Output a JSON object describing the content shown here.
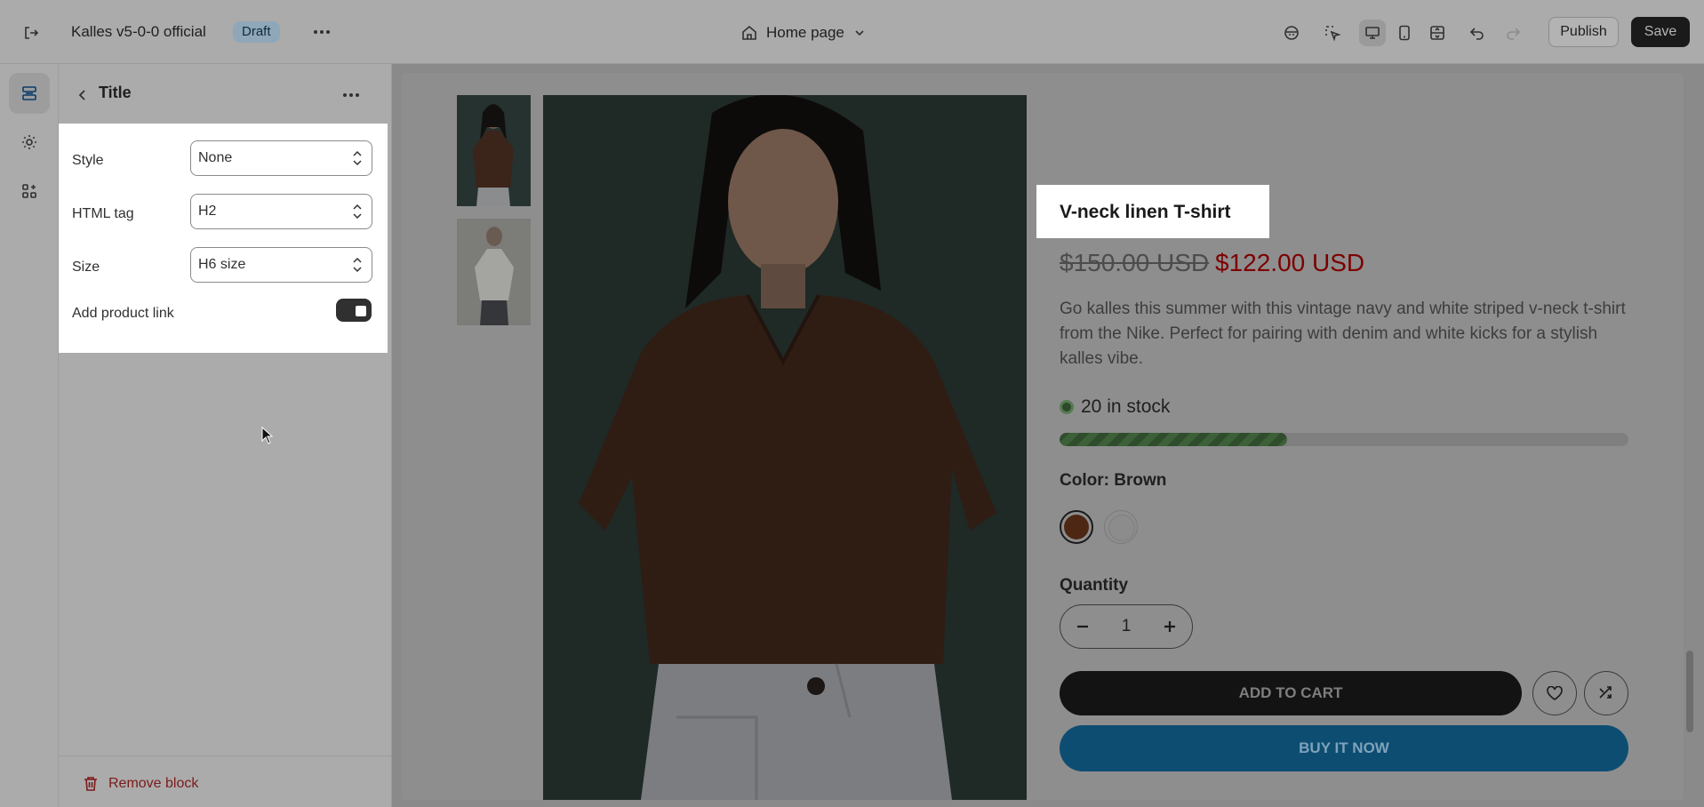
{
  "topbar": {
    "store_name": "Kalles v5-0-0 official",
    "status_badge": "Draft",
    "page_selector": "Home page",
    "publish_label": "Publish",
    "save_label": "Save"
  },
  "panel": {
    "title": "Title",
    "fields": {
      "style": {
        "label": "Style",
        "value": "None"
      },
      "html_tag": {
        "label": "HTML tag",
        "value": "H2"
      },
      "size": {
        "label": "Size",
        "value": "H6 size"
      },
      "product_link": {
        "label": "Add product link",
        "enabled": true
      }
    },
    "remove_label": "Remove block"
  },
  "product": {
    "title": "V-neck linen T-shirt",
    "old_price": "$150.00 USD",
    "new_price": "$122.00 USD",
    "description": "Go kalles this summer with this vintage navy and white striped v-neck t-shirt from the Nike. Perfect for pairing with denim and white kicks for a stylish kalles vibe.",
    "stock_text": "20 in stock",
    "stock_level": 0.4,
    "color_label": "Color:",
    "color_value": "Brown",
    "quantity_label": "Quantity",
    "quantity": "1",
    "add_to_cart": "ADD TO CART",
    "buy_now": "BUY IT NOW"
  },
  "colors": {
    "accent_dark": "#303030",
    "buy_now": "#0d4d72",
    "sale_price": "#7d0000"
  }
}
